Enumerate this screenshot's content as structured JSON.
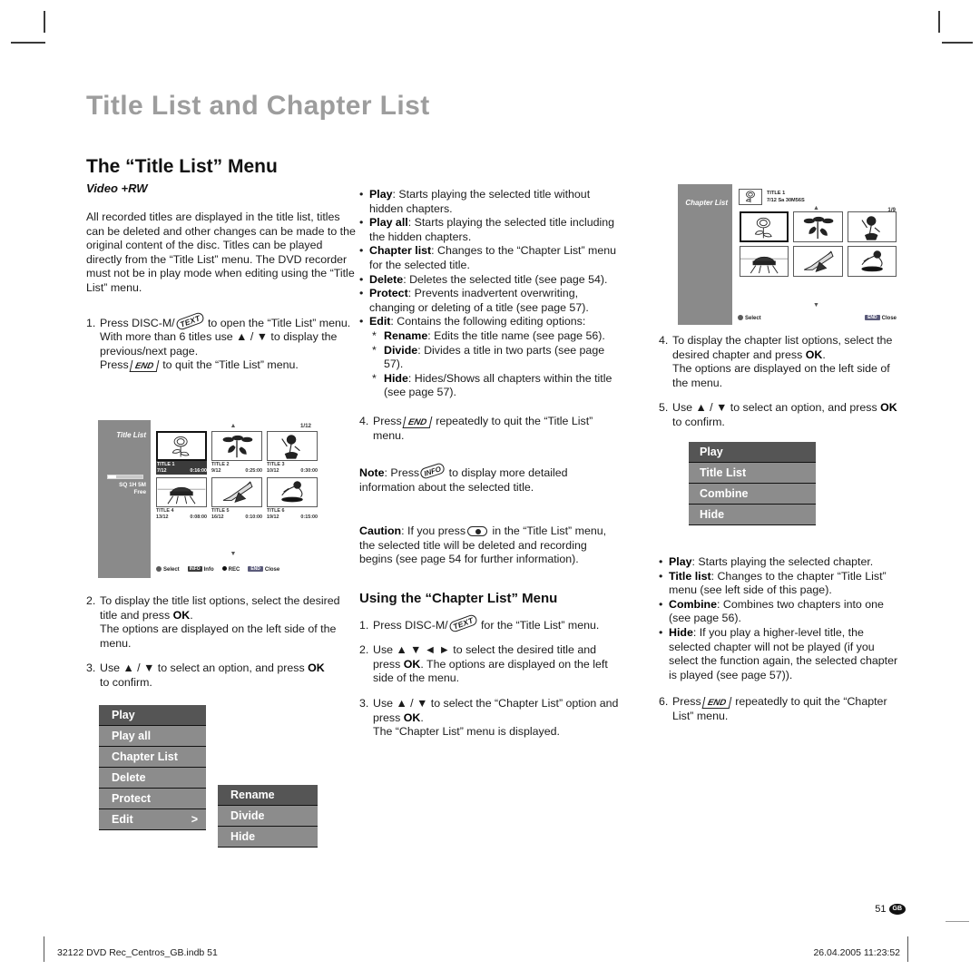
{
  "page": {
    "chapter_title": "Title List and Chapter List",
    "section_title": "The “Title List” Menu",
    "section_subtitle": "Video +RW",
    "page_number": "51",
    "region_code": "GB",
    "footer_left": "32122 DVD Rec_Centros_GB.indb   51",
    "footer_right": "26.04.2005   11:23:52"
  },
  "column1": {
    "intro": "All recorded titles are displayed in the title list, titles can be deleted and other changes can be made to the original content of the disc. Titles can be played directly from the “Title List” menu. The DVD recorder must not be in play mode when editing using the “Title List” menu.",
    "step1": {
      "num": "1.",
      "line1_a": "Press DISC-M/",
      "key1": "TEXT",
      "line1_b": " to open the “Title List” menu.",
      "line2": "With more than 6 titles use ▲ / ▼ to display the previous/next page.",
      "line3_a": "Press",
      "key2": "END",
      "line3_b": " to quit the “Title List” menu."
    },
    "step2": {
      "num": "2.",
      "text_a": "To display the title list options, select the desired title and press ",
      "bold": "OK",
      "text_b": ".",
      "text_c": "The options are displayed on the left side of the menu."
    },
    "step3": {
      "num": "3.",
      "text_a": "Use ▲ / ▼ to select an option, and press ",
      "bold": "OK",
      "text_b": "",
      "text_c": "to confirm."
    }
  },
  "column2": {
    "bullets": [
      {
        "term": "Play",
        "desc": ": Starts playing the selected title without hidden chapters."
      },
      {
        "term": "Play all",
        "desc": ": Starts playing the selected title including the hidden chapters."
      },
      {
        "term": "Chapter list",
        "desc": ": Changes to the “Chapter List” menu for the selected title."
      },
      {
        "term": "Delete",
        "desc": ": Deletes the selected title (see page 54)."
      },
      {
        "term": "Protect",
        "desc": ": Prevents inadvertent overwriting, changing or deleting of a title (see page 57)."
      },
      {
        "term": "Edit",
        "desc": ": Contains the following editing options:"
      }
    ],
    "sub_bullets": [
      {
        "term": "Rename",
        "desc": ": Edits the title name (see page 56)."
      },
      {
        "term": "Divide",
        "desc": ": Divides a title in two parts (see page 57)."
      },
      {
        "term": "Hide",
        "desc": ": Hides/Shows all chapters within the title (see page 57)."
      }
    ],
    "step4": {
      "num": "4.",
      "text_a": "Press",
      "key": "END",
      "text_b": " repeatedly to quit the “Title List” menu."
    },
    "note": {
      "label": "Note",
      "text_a": ": Press",
      "key": "INFO",
      "text_b": " to display more detailed information about the selected title."
    },
    "caution": {
      "label": "Caution",
      "text_a": ": If you press",
      "key": "rec-button",
      "text_b": " in the “Title List” menu, the selected title will be deleted and recording begins (see page 54 for further information)."
    },
    "subsection_title": "Using the “Chapter List” Menu",
    "step_c1": {
      "num": "1.",
      "text_a": "Press DISC-M/",
      "key": "TEXT",
      "text_b": " for the “Title List” menu."
    },
    "step_c2": {
      "num": "2.",
      "text_a": "Use ▲  ▼  ◄  ► to select the desired title and press ",
      "bold": "OK",
      "text_b": ". The options are displayed on the left side of the menu."
    },
    "step_c3": {
      "num": "3.",
      "text_a": "Use ▲ / ▼ to select the “Chapter List” option and press ",
      "bold": "OK",
      "text_b": ".",
      "text_c": "The “Chapter List” menu is displayed."
    }
  },
  "column3": {
    "step4": {
      "num": "4.",
      "text_a": "To display the chapter list options, select the desired chapter and press ",
      "bold": "OK",
      "text_b": ".",
      "text_c": "The options are displayed on the left side of the menu."
    },
    "step5": {
      "num": "5.",
      "text_a": "Use ▲ / ▼ to select an option, and press ",
      "bold": "OK",
      "text_c": "to confirm."
    },
    "bullets": [
      {
        "term": "Play",
        "desc": ": Starts playing the selected chapter."
      },
      {
        "term": "Title list",
        "desc": ": Changes to the chapter “Title List” menu (see left side of this page)."
      },
      {
        "term": "Combine",
        "desc": ": Combines two chapters into one (see page 56)."
      },
      {
        "term": "Hide",
        "desc": ": If you play a higher-level title, the selected chapter will not be played (if you select the function again, the selected chapter is played (see page 57))."
      }
    ],
    "step6": {
      "num": "6.",
      "text_a": "Press",
      "key": "END",
      "text_b": " repeatedly to quit the “Chapter List” menu."
    }
  },
  "osd_title_list": {
    "panel_label": "Title List",
    "free_line1": "SQ 1H 5M",
    "free_line2": "Free",
    "page_indicator": "1/12",
    "titles": [
      {
        "name": "TITLE 1",
        "date": "7/12",
        "time": "0:16:00",
        "selected": true,
        "art": "rose"
      },
      {
        "name": "TITLE 2",
        "date": "9/12",
        "time": "0:25:00",
        "selected": false,
        "art": "plant"
      },
      {
        "name": "TITLE 3",
        "date": "10/12",
        "time": "0:30:00",
        "selected": false,
        "art": "figure"
      },
      {
        "name": "TITLE 4",
        "date": "13/12",
        "time": "0:08:00",
        "selected": false,
        "art": "car"
      },
      {
        "name": "TITLE 5",
        "date": "16/12",
        "time": "0:10:00",
        "selected": false,
        "art": "shuttle"
      },
      {
        "name": "TITLE 6",
        "date": "19/12",
        "time": "0:15:00",
        "selected": false,
        "art": "bird"
      }
    ],
    "footer": {
      "select": "Select",
      "info": "Info",
      "info_badge": "INFO",
      "rec": "REC",
      "close": "Close",
      "close_badge": "END"
    }
  },
  "osd_chapter_list": {
    "panel_label": "Chapter List",
    "header_title": "TITLE 1",
    "header_info": "7/12  Sa   30M56S",
    "page_indicator": "1/9",
    "chapters": [
      {
        "selected": true,
        "art": "rose"
      },
      {
        "selected": false,
        "art": "plant"
      },
      {
        "selected": false,
        "art": "figure"
      },
      {
        "selected": false,
        "art": "car"
      },
      {
        "selected": false,
        "art": "shuttle"
      },
      {
        "selected": false,
        "art": "bird"
      }
    ],
    "footer": {
      "select": "Select",
      "close": "Close",
      "close_badge": "END"
    }
  },
  "menu_title_list": {
    "items": [
      {
        "label": "Play",
        "highlighted": true,
        "caret": ""
      },
      {
        "label": "Play all",
        "highlighted": false,
        "caret": ""
      },
      {
        "label": "Chapter List",
        "highlighted": false,
        "caret": ""
      },
      {
        "label": "Delete",
        "highlighted": false,
        "caret": ""
      },
      {
        "label": "Protect",
        "highlighted": false,
        "caret": ""
      },
      {
        "label": "Edit",
        "highlighted": false,
        "caret": ">"
      }
    ]
  },
  "menu_edit_sub": {
    "items": [
      {
        "label": "Rename",
        "highlighted": true
      },
      {
        "label": "Divide",
        "highlighted": false
      },
      {
        "label": "Hide",
        "highlighted": false
      }
    ]
  },
  "menu_chapter_list": {
    "items": [
      {
        "label": "Play",
        "highlighted": true
      },
      {
        "label": "Title List",
        "highlighted": false
      },
      {
        "label": "Combine",
        "highlighted": false
      },
      {
        "label": "Hide",
        "highlighted": false
      }
    ]
  },
  "colors": {
    "chapter_title": "#9d9d9d",
    "osd_panel": "#8a8a8a",
    "menu_item": "#8c8c8c",
    "menu_highlight": "#555555"
  }
}
